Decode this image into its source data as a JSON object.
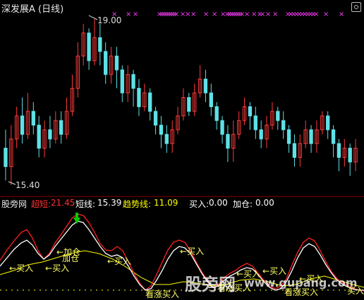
{
  "title": "深发展A (日线)",
  "icons": {
    "settings": "settings-icon",
    "arrow_down": "down-arrow-marker"
  },
  "colors": {
    "up": "#ff3b3b",
    "down": "#5ee1e6",
    "magenta": "#ff3cff",
    "yellow": "#ffff00",
    "white": "#ffffff",
    "green": "#00cc00",
    "red": "#ff2020"
  },
  "main": {
    "high_label": "19.00",
    "low_label": "15.40",
    "top_marker": "×",
    "candles": [
      {
        "o": 16.2,
        "c": 15.8,
        "h": 16.6,
        "l": 15.5
      },
      {
        "o": 15.8,
        "c": 16.4,
        "h": 16.7,
        "l": 15.4
      },
      {
        "o": 16.4,
        "c": 16.9,
        "h": 17.1,
        "l": 16.2
      },
      {
        "o": 16.9,
        "c": 16.5,
        "h": 17.3,
        "l": 16.3
      },
      {
        "o": 16.5,
        "c": 17.0,
        "h": 17.4,
        "l": 16.4
      },
      {
        "o": 17.0,
        "c": 16.7,
        "h": 17.2,
        "l": 16.5
      },
      {
        "o": 16.7,
        "c": 16.2,
        "h": 16.9,
        "l": 16.0
      },
      {
        "o": 16.2,
        "c": 16.6,
        "h": 16.8,
        "l": 16.0
      },
      {
        "o": 16.6,
        "c": 16.4,
        "h": 16.9,
        "l": 16.2
      },
      {
        "o": 16.4,
        "c": 16.8,
        "h": 17.0,
        "l": 16.3
      },
      {
        "o": 16.8,
        "c": 16.5,
        "h": 17.0,
        "l": 16.3
      },
      {
        "o": 16.5,
        "c": 17.0,
        "h": 17.3,
        "l": 16.4
      },
      {
        "o": 17.0,
        "c": 17.5,
        "h": 17.8,
        "l": 16.9
      },
      {
        "o": 17.5,
        "c": 18.2,
        "h": 18.5,
        "l": 17.3
      },
      {
        "o": 18.2,
        "c": 18.7,
        "h": 18.9,
        "l": 18.0
      },
      {
        "o": 18.7,
        "c": 18.1,
        "h": 18.8,
        "l": 17.9
      },
      {
        "o": 18.1,
        "c": 18.6,
        "h": 19.0,
        "l": 18.0
      },
      {
        "o": 18.6,
        "c": 18.3,
        "h": 18.9,
        "l": 18.0
      },
      {
        "o": 18.3,
        "c": 17.8,
        "h": 18.5,
        "l": 17.6
      },
      {
        "o": 17.8,
        "c": 18.2,
        "h": 18.4,
        "l": 17.6
      },
      {
        "o": 18.2,
        "c": 17.9,
        "h": 18.4,
        "l": 17.5
      },
      {
        "o": 17.9,
        "c": 17.4,
        "h": 18.0,
        "l": 17.2
      },
      {
        "o": 17.4,
        "c": 17.8,
        "h": 18.0,
        "l": 17.2
      },
      {
        "o": 17.8,
        "c": 17.5,
        "h": 17.9,
        "l": 17.1
      },
      {
        "o": 17.5,
        "c": 17.1,
        "h": 17.7,
        "l": 16.9
      },
      {
        "o": 17.1,
        "c": 17.4,
        "h": 17.6,
        "l": 17.0
      },
      {
        "o": 17.4,
        "c": 17.0,
        "h": 17.5,
        "l": 16.8
      },
      {
        "o": 17.0,
        "c": 16.7,
        "h": 17.1,
        "l": 16.5
      },
      {
        "o": 16.7,
        "c": 16.5,
        "h": 16.9,
        "l": 16.2
      },
      {
        "o": 16.5,
        "c": 16.3,
        "h": 16.7,
        "l": 16.1
      },
      {
        "o": 16.3,
        "c": 16.6,
        "h": 16.8,
        "l": 16.1
      },
      {
        "o": 16.6,
        "c": 16.9,
        "h": 17.1,
        "l": 16.5
      },
      {
        "o": 16.9,
        "c": 17.3,
        "h": 17.5,
        "l": 16.8
      },
      {
        "o": 17.3,
        "c": 17.0,
        "h": 17.4,
        "l": 16.9
      },
      {
        "o": 17.0,
        "c": 17.4,
        "h": 17.6,
        "l": 16.9
      },
      {
        "o": 17.4,
        "c": 17.7,
        "h": 18.0,
        "l": 17.3
      },
      {
        "o": 17.7,
        "c": 17.4,
        "h": 17.9,
        "l": 17.2
      },
      {
        "o": 17.4,
        "c": 17.1,
        "h": 17.6,
        "l": 16.9
      },
      {
        "o": 17.1,
        "c": 16.8,
        "h": 17.2,
        "l": 16.6
      },
      {
        "o": 16.8,
        "c": 16.5,
        "h": 16.9,
        "l": 16.3
      },
      {
        "o": 16.5,
        "c": 16.2,
        "h": 16.7,
        "l": 15.9
      },
      {
        "o": 16.2,
        "c": 16.5,
        "h": 16.8,
        "l": 15.9
      },
      {
        "o": 16.5,
        "c": 16.8,
        "h": 17.0,
        "l": 16.4
      },
      {
        "o": 16.8,
        "c": 17.1,
        "h": 17.3,
        "l": 16.7
      },
      {
        "o": 17.1,
        "c": 16.9,
        "h": 17.2,
        "l": 16.6
      },
      {
        "o": 16.9,
        "c": 16.6,
        "h": 17.1,
        "l": 16.4
      },
      {
        "o": 16.6,
        "c": 16.4,
        "h": 16.8,
        "l": 16.2
      },
      {
        "o": 16.4,
        "c": 16.7,
        "h": 16.9,
        "l": 16.2
      },
      {
        "o": 16.7,
        "c": 17.0,
        "h": 17.2,
        "l": 16.6
      },
      {
        "o": 17.0,
        "c": 16.8,
        "h": 17.1,
        "l": 16.6
      },
      {
        "o": 16.8,
        "c": 16.6,
        "h": 17.0,
        "l": 16.4
      },
      {
        "o": 16.6,
        "c": 16.3,
        "h": 16.7,
        "l": 16.1
      },
      {
        "o": 16.3,
        "c": 16.0,
        "h": 16.5,
        "l": 15.8
      },
      {
        "o": 16.0,
        "c": 16.3,
        "h": 16.5,
        "l": 15.8
      },
      {
        "o": 16.3,
        "c": 16.6,
        "h": 16.8,
        "l": 16.2
      },
      {
        "o": 16.6,
        "c": 16.3,
        "h": 16.7,
        "l": 16.1
      },
      {
        "o": 16.3,
        "c": 16.6,
        "h": 16.8,
        "l": 16.1
      },
      {
        "o": 16.6,
        "c": 16.9,
        "h": 17.0,
        "l": 16.5
      },
      {
        "o": 16.9,
        "c": 16.6,
        "h": 17.0,
        "l": 16.4
      },
      {
        "o": 16.6,
        "c": 16.3,
        "h": 16.7,
        "l": 16.0
      },
      {
        "o": 16.3,
        "c": 16.0,
        "h": 16.4,
        "l": 15.7
      },
      {
        "o": 16.0,
        "c": 16.2,
        "h": 16.4,
        "l": 15.8
      },
      {
        "o": 16.2,
        "c": 15.9,
        "h": 16.3,
        "l": 15.6
      },
      {
        "o": 15.9,
        "c": 16.2,
        "h": 16.4,
        "l": 15.7
      }
    ],
    "marker_count": 64
  },
  "indicators": {
    "source_label": "股旁网",
    "super_label": "超短:",
    "super_value": "21.45",
    "short_label": "短线:",
    "short_value": "15.39",
    "trend_label": "趋势线:",
    "trend_value": "11.09",
    "buy_label": "买入:",
    "buy_value": "0.00",
    "add_label": "加仓:",
    "add_value": "0.00"
  },
  "signals": {
    "buy": "买入",
    "add": "加仓",
    "look_buy": "看涨买入",
    "arrow": "←"
  },
  "watermark": {
    "cn": "股旁网",
    "url": "www.gupang.com"
  }
}
